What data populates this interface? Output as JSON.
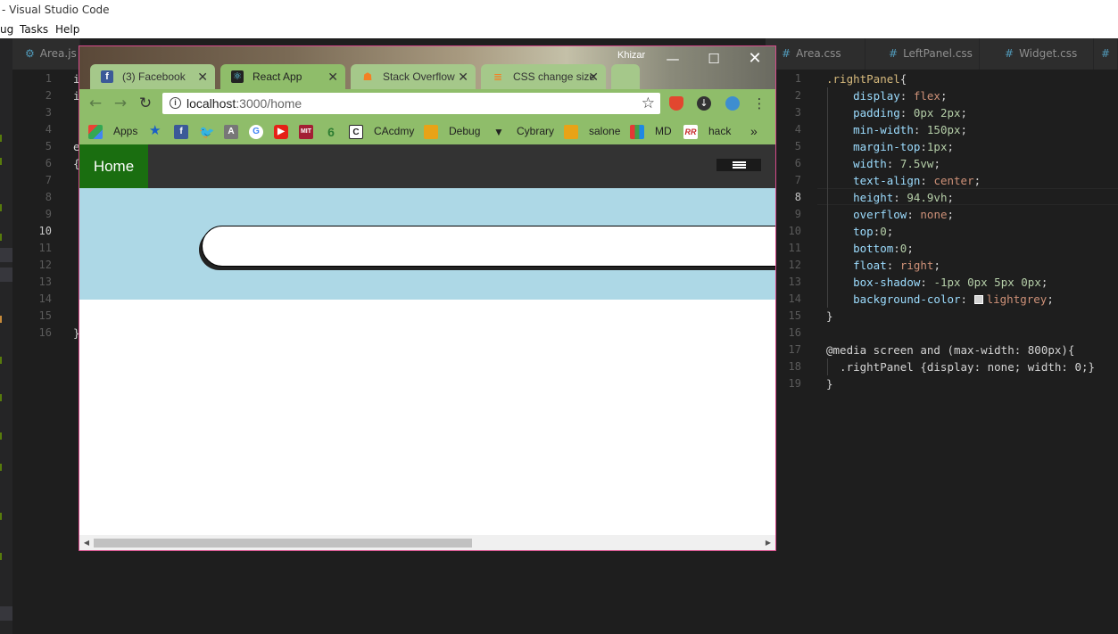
{
  "vscode": {
    "title": "- Visual Studio Code",
    "menu": [
      "ug",
      "Tasks",
      "Help"
    ],
    "tabs": [
      {
        "label": "Area.js",
        "icon": "gear-icon"
      },
      {
        "label": "Area.css",
        "icon": "hash-icon"
      },
      {
        "label": "LeftPanel.css",
        "icon": "hash-icon"
      },
      {
        "label": "Widget.css",
        "icon": "hash-icon"
      }
    ],
    "left_line_numbers": [
      "1",
      "2",
      "3",
      "4",
      "5",
      "6",
      "7",
      "8",
      "9",
      "10",
      "11",
      "12",
      "13",
      "14",
      "15",
      "16"
    ],
    "left_code": [
      "i",
      "i",
      "",
      "",
      "e",
      "{",
      "",
      "",
      "",
      "",
      "",
      "",
      "",
      "",
      "",
      "}"
    ],
    "right_line_numbers": [
      "1",
      "2",
      "3",
      "4",
      "5",
      "6",
      "7",
      "8",
      "9",
      "10",
      "11",
      "12",
      "13",
      "14",
      "15",
      "16",
      "17",
      "18",
      "19"
    ],
    "css": {
      "selector": ".rightPanel",
      "rules": [
        {
          "prop": "display",
          "val": "flex"
        },
        {
          "prop": "padding",
          "val": "0px 2px"
        },
        {
          "prop": "min-width",
          "val": "150px"
        },
        {
          "prop": "margin-top",
          "val": "1px"
        },
        {
          "prop": "width",
          "val": "7.5vw"
        },
        {
          "prop": "text-align",
          "val": "center"
        },
        {
          "prop": "height",
          "val": "94.9vh"
        },
        {
          "prop": "overflow",
          "val": "none"
        },
        {
          "prop": "top",
          "val": "0"
        },
        {
          "prop": "bottom",
          "val": "0"
        },
        {
          "prop": "float",
          "val": "right"
        },
        {
          "prop": "box-shadow",
          "val": "-1px 0px 5px 0px"
        },
        {
          "prop": "background-color",
          "val": "lightgrey"
        }
      ],
      "media_line": "@media screen and (max-width: 800px){",
      "media_rule": "  .rightPanel {display: none; width: 0;}"
    }
  },
  "chrome": {
    "user": "Khizar",
    "tabs": [
      {
        "label": "(3) Facebook",
        "color": "#3b5998"
      },
      {
        "label": "React App",
        "color": "#222222"
      },
      {
        "label": "Stack Overflow",
        "color": "#f48024"
      },
      {
        "label": "CSS change size",
        "color": "#f48024"
      }
    ],
    "url_host": "localhost",
    "url_path": ":3000/home",
    "bookmarks": [
      "Apps",
      "CAcdmy",
      "Debug",
      "Cybrary",
      "salone",
      "MD",
      "hack"
    ],
    "page": {
      "nav_home": "Home",
      "nav_color": "#1a6e10",
      "hero_color": "#add8e6"
    }
  }
}
